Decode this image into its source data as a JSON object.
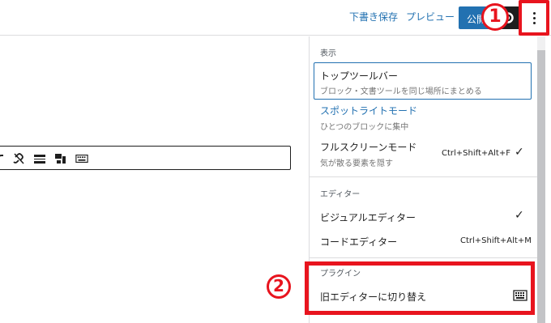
{
  "header": {
    "save_draft": "下書き保存",
    "preview": "プレビュー",
    "publish": "公開",
    "annotation_1": "1"
  },
  "menu": {
    "view": {
      "label": "表示",
      "top_toolbar": {
        "label": "トップツールバー",
        "desc": "ブロック・文書ツールを同じ場所にまとめる"
      },
      "spotlight": {
        "label": "スポットライトモード",
        "desc": "ひとつのブロックに集中"
      },
      "fullscreen": {
        "label": "フルスクリーンモード",
        "desc": "気が散る要素を隠す",
        "shortcut": "Ctrl+Shift+Alt+F",
        "check": "✓"
      }
    },
    "editor": {
      "label": "エディター",
      "visual": {
        "label": "ビジュアルエディター",
        "check": "✓"
      },
      "code": {
        "label": "コードエディター",
        "shortcut": "Ctrl+Shift+Alt+M"
      }
    },
    "plugins": {
      "label": "プラグイン",
      "classic_switch": {
        "label": "旧エディターに切り替え"
      }
    }
  },
  "annotations": {
    "circle2": "2"
  },
  "colors": {
    "accent": "#2271b1",
    "annotation": "#e8141e"
  }
}
